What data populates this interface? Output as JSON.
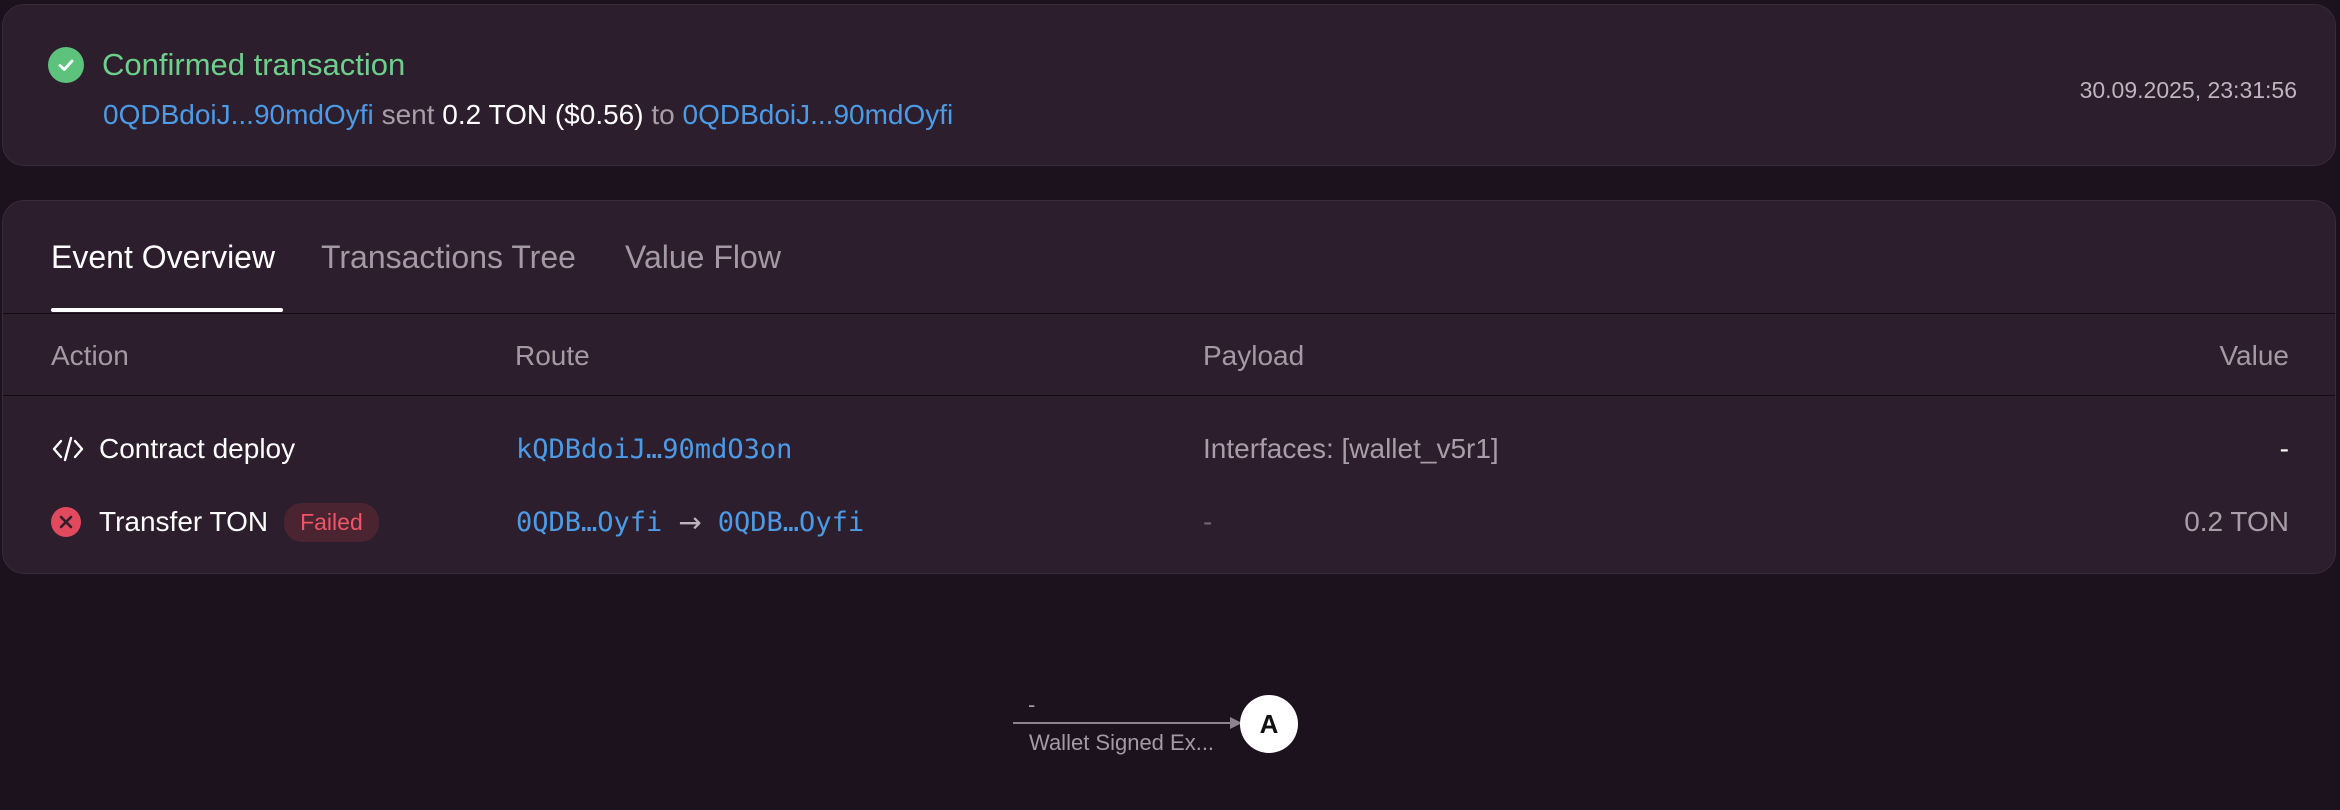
{
  "summary": {
    "status_title": "Confirmed transaction",
    "from_address": "0QDBdoiJ...90mdOyfi",
    "sent_word": "sent",
    "amount": "0.2 TON ($0.56)",
    "to_word": "to",
    "to_address": "0QDBdoiJ...90mdOyfi",
    "timestamp": "30.09.2025, 23:31:56"
  },
  "tabs": [
    {
      "label": "Event Overview",
      "active": true
    },
    {
      "label": "Transactions Tree",
      "active": false
    },
    {
      "label": "Value Flow",
      "active": false
    }
  ],
  "table": {
    "headers": {
      "action": "Action",
      "route": "Route",
      "payload": "Payload",
      "value": "Value"
    },
    "rows": [
      {
        "icon": "code-icon",
        "action": "Contract deploy",
        "route": "kQDBdoiJ…90mdO3on",
        "payload": "Interfaces: [wallet_v5r1]",
        "value": "-"
      },
      {
        "icon": "error-x-icon",
        "action": "Transfer TON",
        "badge": "Failed",
        "route_from": "0QDB…Oyfi",
        "route_arrow": "→",
        "route_to": "0QDB…Oyfi",
        "payload": "-",
        "value": "0.2 TON"
      }
    ]
  },
  "graph": {
    "edge_top_label": "-",
    "edge_label": "Wallet Signed Ex...",
    "node_label": "A"
  },
  "colors": {
    "background": "#1b121d",
    "card": "#2c1e2d",
    "success": "#6dd08a",
    "link": "#4c9be6",
    "error": "#e04a5c"
  }
}
